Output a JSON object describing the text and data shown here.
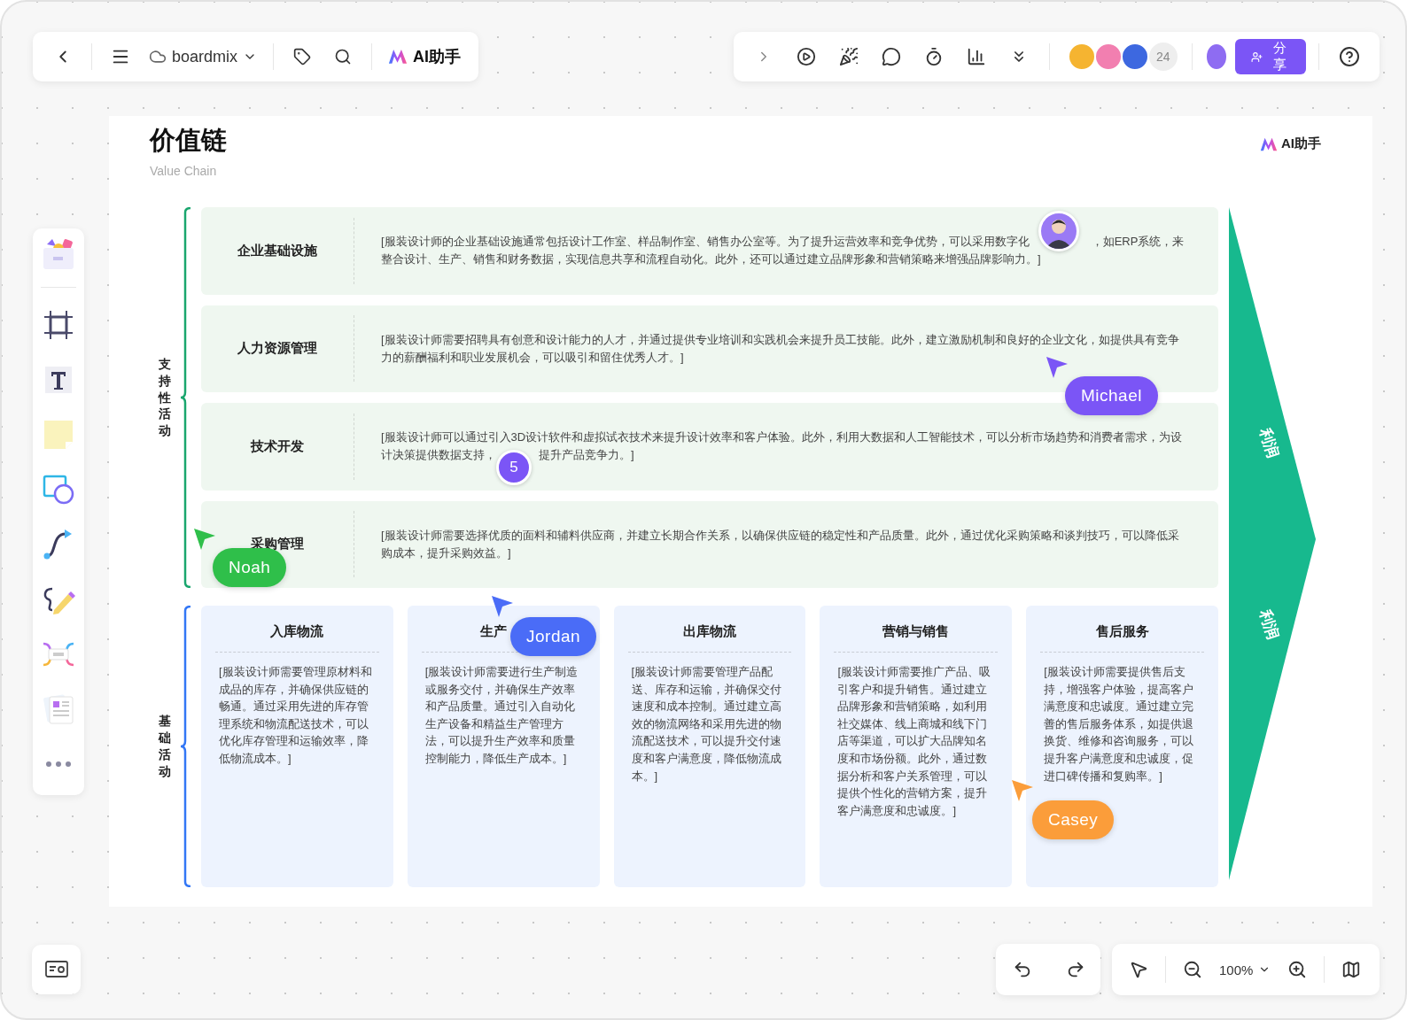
{
  "toolbar": {
    "doc_name": "boardmix",
    "ai_label": "AI助手",
    "collaborator_count": "24",
    "share_label": "分享"
  },
  "board": {
    "title": "价值链",
    "subtitle": "Value Chain",
    "ai_badge": "AI助手"
  },
  "support": {
    "label": "支持性活动",
    "rows": [
      {
        "title": "企业基础设施",
        "text": [
          "[服装设计师的企业基础设施通常包括设计工作室、样品制作室、销售办公室等。为了提升运营效率和竞争优势，可以采用数字化",
          "，如ERP系统，来整合设计、生产、销售和财务数据，实现信息共享和流程自动化。此外，还可以通过建立品牌形象和营销策略来增强品牌影响力。]"
        ]
      },
      {
        "title": "人力资源管理",
        "text": [
          "[服装设计师需要招聘具有创意和设计能力的人才，并通过提供专业培训和实践机会来提升员工技能。此外，建立激励机制和良好的企业文化，如提供具有竞争力的薪酬福利和职业发展机会，可以吸引和留住优秀人才。]"
        ]
      },
      {
        "title": "技术开发",
        "text": [
          "[服装设计师可以通过引入3D设计软件和虚拟试衣技术来提升设计效率和客户体验。此外，利用大数据和人工智能技术，可以分析市场趋势和消费者需求，为设计决策提供数据支持，",
          "提升产品竞争力。]"
        ]
      },
      {
        "title": "采购管理",
        "text": [
          "[服装设计师需要选择优质的面料和辅料供应商，并建立长期合作关系，以确保供应链的稳定性和产品质量。此外，通过优化采购策略和谈判技巧，可以降低采购成本，提升采购效益。]"
        ]
      }
    ]
  },
  "primary": {
    "label": "基础活动",
    "columns": [
      {
        "title": "入库物流",
        "text": "[服装设计师需要管理原材料和成品的库存，并确保供应链的畅通。通过采用先进的库存管理系统和物流配送技术，可以优化库存管理和运输效率，降低物流成本。]"
      },
      {
        "title": "生产",
        "text": "[服装设计师需要进行生产制造或服务交付，并确保生产效率和产品质量。通过引入自动化生产设备和精益生产管理方法，可以提升生产效率和质量控制能力，降低生产成本。]"
      },
      {
        "title": "出库物流",
        "text": "[服装设计师需要管理产品配送、库存和运输，并确保交付速度和成本控制。通过建立高效的物流网络和采用先进的物流配送技术，可以提升交付速度和客户满意度，降低物流成本。]"
      },
      {
        "title": "营销与销售",
        "text": "[服装设计师需要推广产品、吸引客户和提升销售。通过建立品牌形象和营销策略，如利用社交媒体、线上商城和线下门店等渠道，可以扩大品牌知名度和市场份额。此外，通过数据分析和客户关系管理，可以提供个性化的营销方案，提升客户满意度和忠诚度。]"
      },
      {
        "title": "售后服务",
        "text": "[服装设计师需要提供售后支持，增强客户体验，提高客户满意度和忠诚度。通过建立完善的售后服务体系，如提供退换货、维修和咨询服务，可以提升客户满意度和忠诚度，促进口碑传播和复购率。]"
      }
    ]
  },
  "margin": {
    "labels": [
      "利润",
      "利润"
    ]
  },
  "cursors": [
    {
      "name": "Michael",
      "color": "#7b55f6"
    },
    {
      "name": "Noah",
      "color": "#2fbf4a"
    },
    {
      "name": "Jordan",
      "color": "#4a6cf7"
    },
    {
      "name": "Casey",
      "color": "#fb9d3a"
    }
  ],
  "comment_count": "5",
  "zoom": "100%"
}
